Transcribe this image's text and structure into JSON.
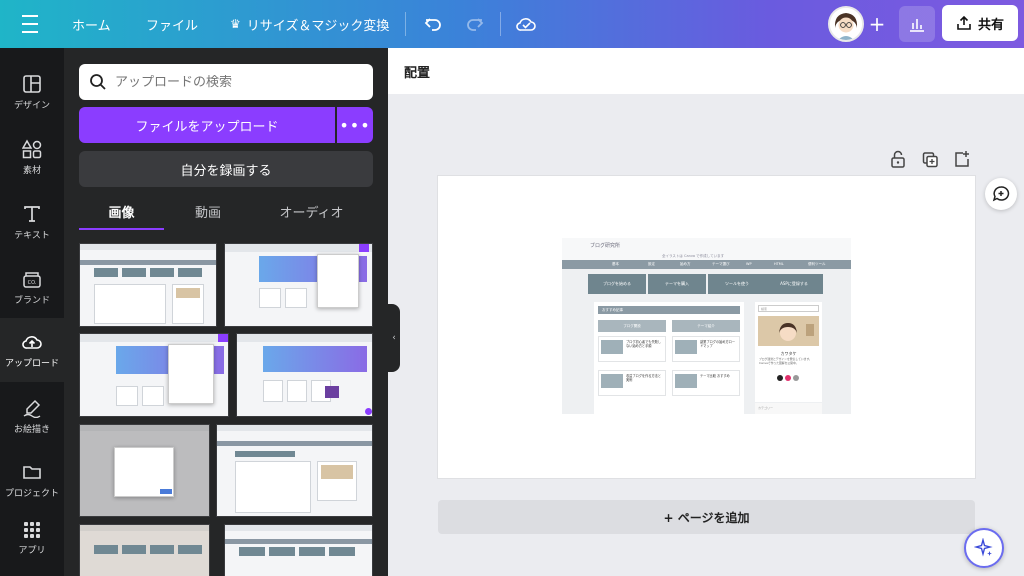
{
  "topbar": {
    "home": "ホーム",
    "file": "ファイル",
    "resize": "リサイズ＆マジック変換",
    "share": "共有"
  },
  "rail": {
    "items": [
      {
        "label": "デザイン",
        "icon": "layout-icon"
      },
      {
        "label": "素材",
        "icon": "shapes-icon"
      },
      {
        "label": "テキスト",
        "icon": "text-icon"
      },
      {
        "label": "ブランド",
        "icon": "brand-icon"
      },
      {
        "label": "アップロード",
        "icon": "upload-cloud-icon"
      },
      {
        "label": "お絵描き",
        "icon": "draw-icon"
      },
      {
        "label": "プロジェクト",
        "icon": "folder-icon"
      },
      {
        "label": "アプリ",
        "icon": "apps-icon"
      }
    ],
    "active": "アップロード"
  },
  "panel": {
    "search_placeholder": "アップロードの検索",
    "upload_label": "ファイルをアップロード",
    "more": "•••",
    "record_label": "自分を録画する",
    "tabs": [
      "画像",
      "動画",
      "オーディオ"
    ],
    "active_tab": "画像"
  },
  "editor": {
    "header_title": "配置",
    "add_page": "+ ページを追加"
  },
  "preview": {
    "logo": "ブログ研究所",
    "subtitle": "全イラストは Canva で作成しています",
    "nav": [
      "基本",
      "設定",
      "始め方",
      "テーマ選び",
      "WP",
      "HTML",
      "便利ツール"
    ],
    "features": [
      "ブログを始める",
      "テーマを購入",
      "ツールを使う",
      "ASPに登録する"
    ],
    "section": "おすすめ記事",
    "columns": [
      "ブログ開設",
      "テーマ紹介"
    ],
    "articles": [
      "ブログ初心者でも失敗しない始め方と手順",
      "副業ブログの始め方ロードマップ",
      "収益ブログを作る方法と実例",
      "テーマ比較 おすすめ"
    ],
    "side_search": "検索",
    "side_name": "カワタケ",
    "side_bio": "ブログ運営とデザインを発信しています。Canvaで作った図解を公開中。",
    "side_category": "カテゴリー"
  }
}
